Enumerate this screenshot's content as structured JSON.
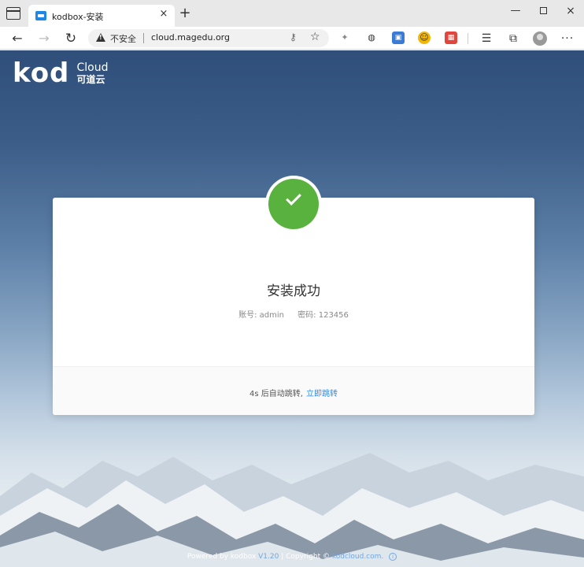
{
  "browser": {
    "tab_title": "kodbox-安装",
    "tab_close": "×",
    "new_tab": "+",
    "address": {
      "insecure_label": "不安全",
      "url": "cloud.magedu.org"
    },
    "window": {
      "minimize": "—",
      "close": "×"
    },
    "more": "···"
  },
  "page": {
    "logo": {
      "kod": "kod",
      "cloud": "Cloud",
      "cn": "可道云"
    },
    "card": {
      "title": "安装成功",
      "account_label": "账号: admin",
      "password_label": "密码: 123456",
      "countdown": "4s 后自动跳转,",
      "jump_link": "立即跳转"
    },
    "footer": {
      "powered_by": "Powered by kodbox",
      "version": "V1.20",
      "separator": "|",
      "copyright": "Copyright ©",
      "site": "kodcloud.com.",
      "info": "i"
    }
  },
  "colors": {
    "success": "#5ab23e",
    "link": "#2d8cf0"
  }
}
